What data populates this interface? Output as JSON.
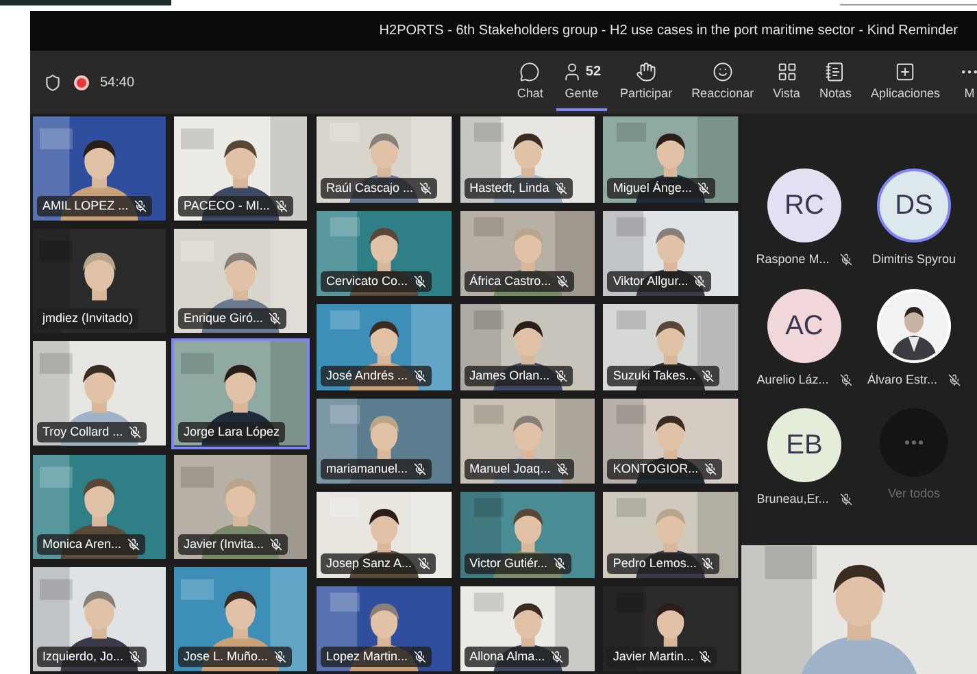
{
  "window": {
    "title": "H2PORTS - 6th Stakeholders group - H2 use cases in the port maritime sector - Kind Reminder"
  },
  "toolbar": {
    "recording": true,
    "timer": "54:40",
    "buttons": [
      {
        "kind": "chat",
        "label": "Chat",
        "selected": false
      },
      {
        "kind": "people",
        "label": "Gente",
        "badge": "52",
        "selected": true
      },
      {
        "kind": "raise-hand",
        "label": "Participar",
        "selected": false
      },
      {
        "kind": "react",
        "label": "Reaccionar",
        "selected": false
      },
      {
        "kind": "view",
        "label": "Vista",
        "selected": false
      },
      {
        "kind": "notes",
        "label": "Notas",
        "selected": false
      },
      {
        "kind": "apps",
        "label": "Aplicaciones",
        "selected": false
      },
      {
        "kind": "more",
        "label": "M",
        "selected": false
      }
    ]
  },
  "gallery_left": [
    {
      "name": "AMIL LOPEZ ...",
      "muted": true,
      "speaking": false
    },
    {
      "name": "PACECO - MI...",
      "muted": true,
      "speaking": false
    },
    {
      "name": "jmdiez (Invitado)",
      "muted": false,
      "speaking": false
    },
    {
      "name": "Enrique Giró...",
      "muted": true,
      "speaking": false
    },
    {
      "name": "Troy Collard ...",
      "muted": true,
      "speaking": false
    },
    {
      "name": "Jorge Lara López",
      "muted": false,
      "speaking": true
    },
    {
      "name": "Monica Aren...",
      "muted": true,
      "speaking": false
    },
    {
      "name": "Javier (Invita...",
      "muted": true,
      "speaking": false
    },
    {
      "name": "Izquierdo, Jo...",
      "muted": true,
      "speaking": false
    },
    {
      "name": "Jose L. Muño...",
      "muted": true,
      "speaking": false
    }
  ],
  "gallery_right": [
    {
      "name": "Raúl Cascajo ...",
      "muted": true,
      "speaking": false
    },
    {
      "name": "Hastedt, Linda",
      "muted": true,
      "speaking": false
    },
    {
      "name": "Miguel Ánge...",
      "muted": true,
      "speaking": false
    },
    {
      "name": "Cervicato Co...",
      "muted": true,
      "speaking": false
    },
    {
      "name": "África Castro...",
      "muted": true,
      "speaking": false
    },
    {
      "name": "Viktor Allgur...",
      "muted": true,
      "speaking": false
    },
    {
      "name": "José Andrés ...",
      "muted": true,
      "speaking": false
    },
    {
      "name": "James Orlan...",
      "muted": true,
      "speaking": false
    },
    {
      "name": "Suzuki Takes...",
      "muted": true,
      "speaking": false
    },
    {
      "name": "mariamanuel...",
      "muted": true,
      "speaking": false
    },
    {
      "name": "Manuel Joaq...",
      "muted": true,
      "speaking": false
    },
    {
      "name": "KONTOGIOR...",
      "muted": true,
      "speaking": false
    },
    {
      "name": "Josep Sanz A...",
      "muted": true,
      "speaking": false
    },
    {
      "name": "Victor Gutiér...",
      "muted": true,
      "speaking": false
    },
    {
      "name": "Pedro Lemos...",
      "muted": true,
      "speaking": false
    },
    {
      "name": "Lopez Martin...",
      "muted": true,
      "speaking": false
    },
    {
      "name": "Allona Alma...",
      "muted": true,
      "speaking": false
    },
    {
      "name": "Javier Martin...",
      "muted": true,
      "speaking": false
    }
  ],
  "side_panel": {
    "participants": [
      {
        "kind": "initials",
        "initials": "RC",
        "name": "Raspone M...",
        "muted": true,
        "speaking": false,
        "color": "#e4e0f4"
      },
      {
        "kind": "initials",
        "initials": "DS",
        "name": "Dimitris Spyrou",
        "muted": false,
        "speaking": true,
        "color": "#dce8ec"
      },
      {
        "kind": "initials",
        "initials": "AC",
        "name": "Aurelio Láz...",
        "muted": true,
        "speaking": false,
        "color": "#f1d6da"
      },
      {
        "name": "Álvaro Estr...",
        "muted": true,
        "speaking": false
      },
      {
        "kind": "initials",
        "initials": "EB",
        "name": "Bruneau,Er...",
        "muted": true,
        "speaking": false,
        "color": "#e4edd9"
      },
      {
        "kind": "more",
        "label": "Ver todos"
      }
    ]
  }
}
